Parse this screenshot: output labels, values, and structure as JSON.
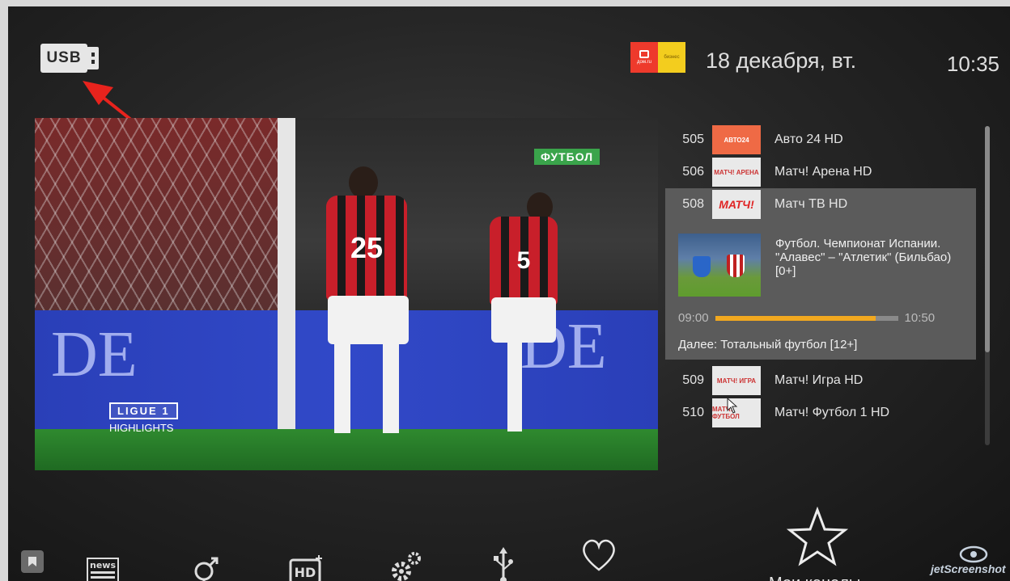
{
  "header": {
    "usb_label": "USB",
    "date": "18 декабря, вт.",
    "time": "10:35",
    "brand_left": "дом.ru",
    "brand_right": "бизнес"
  },
  "preview": {
    "sport_tag": "ФУТБОЛ",
    "ligue_badge": "LIGUE 1",
    "ligue_sub": "HIGHLIGHTS",
    "player1_number": "25",
    "player2_number": "5",
    "ad_text_1": "DE",
    "ad_text_2": "DE"
  },
  "channels": {
    "items": [
      {
        "number": "505",
        "logo": "АВТО24",
        "name": "Авто 24 HD"
      },
      {
        "number": "506",
        "logo": "МАТЧ! АРЕНА",
        "name": "Матч! Арена HD"
      },
      {
        "number": "508",
        "logo": "МАТЧ!",
        "name": "Матч ТВ HD"
      },
      {
        "number": "509",
        "logo": "МАТЧ! ИГРА",
        "name": "Матч! Игра HD"
      },
      {
        "number": "510",
        "logo": "МАТЧ! ФУТБОЛ",
        "name": "Матч! Футбол 1 HD"
      }
    ],
    "selected": {
      "program_title": "Футбол. Чемпионат Испании. \"Алавес\" – \"Атлетик\" (Бильбао) [0+]",
      "start_time": "09:00",
      "end_time": "10:50",
      "progress_fraction": 0.88,
      "next_program": "Далее: Тотальный футбол [12+]"
    }
  },
  "bottom_menu": {
    "icons": [
      "bookmark-icon",
      "news-icon",
      "gender-icon",
      "hd-icon",
      "settings-icon",
      "usb-icon",
      "heart-icon",
      "star-icon"
    ],
    "news_label": "news",
    "hd_label": "HD",
    "my_channels_label": "Мои каналы"
  },
  "watermark": "jetScreenshot"
}
